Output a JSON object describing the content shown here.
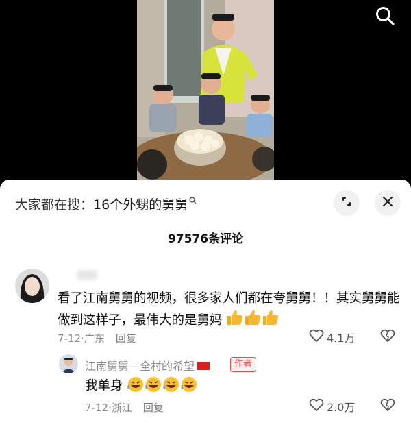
{
  "search": {
    "label": "大家都在搜：",
    "term": "16个外甥的舅舅",
    "icon": "search-icon"
  },
  "panel": {
    "comment_count": "97576条评论"
  },
  "comments": [
    {
      "text": "看了江南舅舅的视频，很多家人们都在夸舅舅！！其实舅舅能做到这样子，最伟大的是舅妈",
      "emoji": "thumbs-up",
      "date": "7-12",
      "location": "广东",
      "reply_label": "回复",
      "likes": "4.1万"
    }
  ],
  "reply": {
    "author": "江南舅舅—全村的希望",
    "badge": "作者",
    "text": "我单身",
    "emoji": "rolling-laughing-face",
    "date": "7-12",
    "location": "浙江",
    "reply_label": "回复",
    "likes": "2.0万"
  },
  "colors": {
    "accent_badge": "#f04a4a",
    "thumb": "#f5a623",
    "panel_bg": "#ffffff",
    "meta": "#8a8a8a"
  }
}
